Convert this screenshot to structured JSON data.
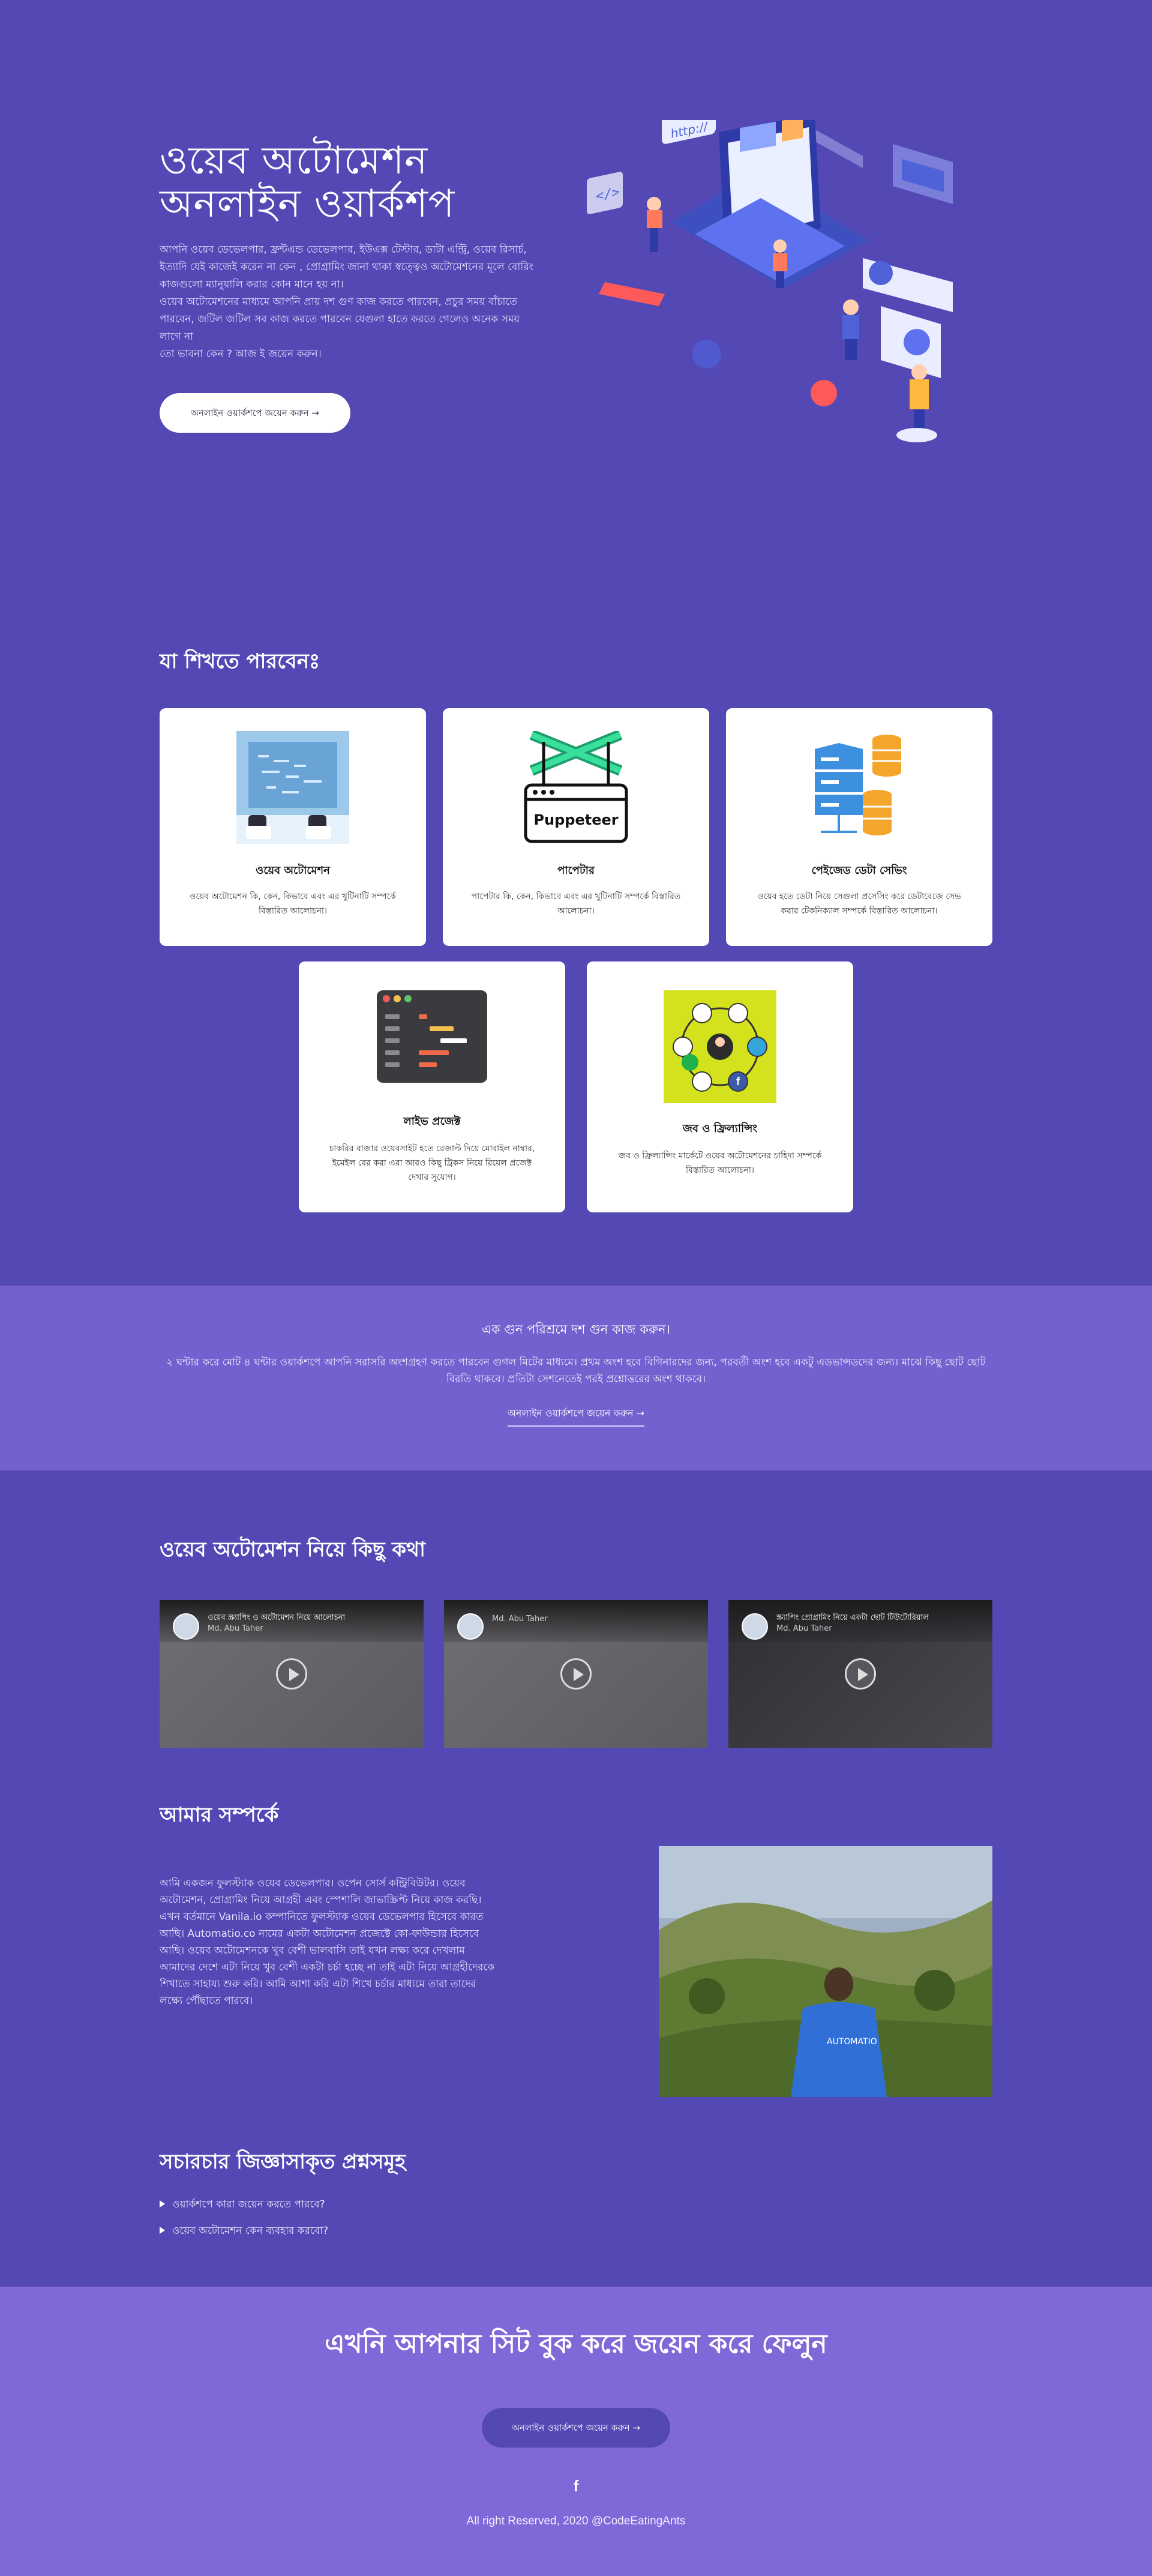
{
  "hero": {
    "title_line1": "ওয়েব অটোমেশন",
    "title_line2": "অনলাইন ওয়ার্কশপ",
    "desc1": "আপনি ওয়েব ডেভেলপার, ফ্রন্টএন্ড ডেভেলপার, ইউএক্স টেস্টার, ডাটা এন্ট্রি, ওয়েব রিসার্চ,",
    "desc2": "ইত্যাদি যেই কাজেই করেন না কেন , প্রোগ্রামিং জানা থাকা স্বত্ত্বেও অটোমেশনের মূলে বোরিং",
    "desc3": "কাজগুলো ম্যানুয়ালি করার কোন মানে হয় না।",
    "desc4": "ওয়েব অটোমেশনের মাধ্যমে আপনি প্রায় দশ গুণ কাজ করতে পারবেন, প্রচুর সময় বাঁচাতে",
    "desc5": "পারবেন, জটিল জটিল সব কাজ করতে পারবেন যেগুলা হাতে করতে গেলেও অনেক সময়",
    "desc6": "লাগে না",
    "desc7": "তো ভাবনা কেন ? আজ ই জয়েন করুন।",
    "button": "অনলাইন ওয়ার্কশপে জয়েন করুন →"
  },
  "learn": {
    "title": "যা শিখতে পারবেনঃ",
    "cards": [
      {
        "title": "ওয়েব অটোমেশন",
        "desc": "ওয়েব অটোমেশন কি, কেন, কিভাবে এবং এর খুটিনাটি সম্পর্কে বিস্তারিত আলোচনা।",
        "icon": "automation-illustration"
      },
      {
        "title": "পাপেটার",
        "desc": "পাপেটার কি, কেন, কিভাবে এবং এর খুটিনাটি সম্পর্কে বিস্তারিত আলোচনা।",
        "icon": "puppeteer-logo",
        "logo_text": "Puppeteer"
      },
      {
        "title": "পেইজেড ডেটা সেভিং",
        "desc": "ওয়েব হতে ডেটা নিয়ে সেগুলা প্রসেসিং করে ডেটাবেজে সেভ করার টেকনিক্যাল সম্পর্কে বিস্তারিত আলোচনা।",
        "icon": "database-server-illustration"
      },
      {
        "title": "লাইভ প্রজেক্ট",
        "desc": "চাকরির বাজার ওয়েবসাইট হতে রেজাল্ট দিয়ে মোবাইল নাম্বার, ইমেইল বের করা এরা আরও কিছু ট্রিকস নিয়ে রিয়েল প্রজেক্ট দেখার সুযোগ।",
        "icon": "code-editor-illustration"
      },
      {
        "title": "জব ও ফ্রিল্যান্সিং",
        "desc": "জব ও ফ্রিল্যান্সিং মার্কেটে ওয়েব অটোমেশনের চাহিদা সম্পর্কে বিস্তারিত আলোচনা।",
        "icon": "freelancing-network-illustration"
      }
    ]
  },
  "band": {
    "title": "এক গুন পরিশ্রমে দশ গুন কাজ করুন।",
    "desc": "২ ঘন্টার করে মোট ৪ ঘন্টার ওয়ার্কশপে আপনি সরাসরি অংশগ্রহণ করতে পারবেন গুগল মিটের মাধ্যমে। প্রথম অংশ হবে বিগিনারদের জন্য, পরবর্তী অংশ হবে একটু এডভান্সডদের জন্য। মাঝে কিছু ছোট ছোট বিরতি থাকবে। প্রতিটা সেশনেতেই পরই প্রশ্নোত্তরের অংশ থাকবে।",
    "link": "অনলাইন ওয়ার্কশপে জয়েন করুন →"
  },
  "talk": {
    "title": "ওয়েব অটোমেশন নিয়ে কিছু কথা",
    "videos": [
      {
        "title": "ওয়েব স্ক্র্যাপিং ও অটোমেশন নিয়ে আলোচনা",
        "channel": "Md. Abu Taher"
      },
      {
        "title": "",
        "channel": "Md. Abu Taher"
      },
      {
        "title": "স্ক্র্যাপিং প্রোগ্রামিং নিয়ে একটা ছোট টিউটোরিয়াল",
        "channel": "Md. Abu Taher"
      }
    ]
  },
  "about": {
    "title": "আমার সম্পর্কে",
    "text": "আমি একজন ফুলস্ট্যাক ওয়েব ডেভেলপার। ওপেন সোর্স কন্ট্রিবিউটর। ওয়েব অটোমেশন, প্রোগ্রামিং নিয়ে আগ্রহী এবং স্পেশালি জাভাস্ক্রিপ্ট নিয়ে কাজ করছি। এখন বর্তমানে Vanila.io কম্পানিতে ফুলস্ট্যাক ওয়েব ডেভেলপার হিসেবে কারত আছি। Automatio.co নামের একটা অটোমেশন প্রজেক্টে কো-ফাউন্ডার হিসেবে আছি। ওয়েব অটোমেশনকে খুব বেশী ভালবাসি তাই যখন লক্ষ্য করে দেখলাম আমাদের দেশে এটা নিয়ে খুব বেশী একটা চর্চা হচ্ছে না তাই এটা নিয়ে আগ্রহীদেরকে শিখাতে সাহায্য শুরু করি। আমি আশা করি এটা শিখে চর্চার মাধ্যমে তারা তাদের লক্ষ্যে পৌঁছাতে পারবে।"
  },
  "faq": {
    "title": "সচারচার জিজ্ঞাসাকৃত প্রশ্নসমূহ",
    "items": [
      "ওয়ার্কশপে কারা জয়েন করতে পারবে?",
      "ওয়েব অটোমেশন কেন ব্যবহার করবো?"
    ]
  },
  "footer": {
    "cta_title": "এখনি আপনার সিট বুক করে জয়েন করে ফেলুন",
    "button": "অনলাইন ওয়ার্কশপে জয়েন করুন →",
    "social_icon": "f",
    "copyright": "All right Reserved, 2020 @CodeEatingAnts"
  },
  "colors": {
    "primary": "#5448b5",
    "band": "#7461cf",
    "footer": "#8068d8"
  }
}
